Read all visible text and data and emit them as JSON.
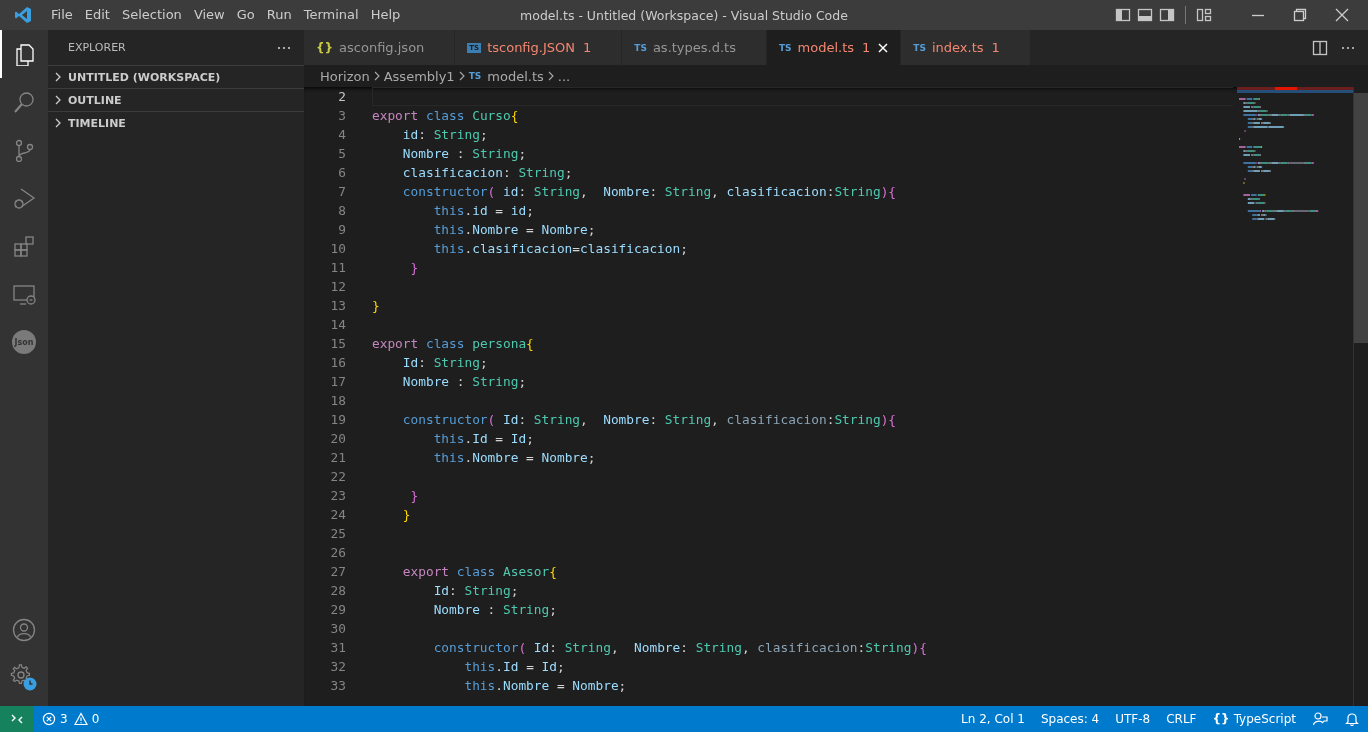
{
  "window": {
    "title": "model.ts - Untitled (Workspace) - Visual Studio Code"
  },
  "menu": [
    "File",
    "Edit",
    "Selection",
    "View",
    "Go",
    "Run",
    "Terminal",
    "Help"
  ],
  "activity_bar": [
    {
      "kind": "files",
      "selected": true
    },
    {
      "kind": "search",
      "selected": false
    },
    {
      "kind": "scm",
      "selected": false
    },
    {
      "kind": "debug",
      "selected": false
    },
    {
      "kind": "extensions",
      "selected": false
    },
    {
      "kind": "remote",
      "selected": false
    },
    {
      "kind": "json",
      "label": "Json",
      "selected": false
    }
  ],
  "activity_bottom": [
    {
      "kind": "account"
    },
    {
      "kind": "settings"
    }
  ],
  "sidebar": {
    "title": "EXPLORER",
    "sections": [
      {
        "label": "UNTITLED (WORKSPACE)",
        "expanded": false
      },
      {
        "label": "OUTLINE",
        "expanded": false
      },
      {
        "label": "TIMELINE",
        "expanded": false
      }
    ]
  },
  "tabs": [
    {
      "kind": "json",
      "icon_text": "{}",
      "label": "asconfig.json",
      "error": false,
      "selected": false
    },
    {
      "kind": "tsconfig",
      "icon_text": "TS",
      "label": "tsconfig.JSON",
      "problems": "1",
      "error": true,
      "selected": false
    },
    {
      "kind": "ts",
      "icon_text": "TS",
      "label": "as.types.d.ts",
      "error": false,
      "selected": false
    },
    {
      "kind": "ts",
      "icon_text": "TS",
      "label": "model.ts",
      "problems": "1",
      "error": true,
      "selected": true
    },
    {
      "kind": "ts",
      "icon_text": "TS",
      "label": "index.ts",
      "problems": "1",
      "error": true,
      "selected": false
    }
  ],
  "breadcrumb": [
    {
      "label": "Horizon"
    },
    {
      "label": "Assembly1"
    },
    {
      "label": "model.ts",
      "icon_text": "TS"
    },
    {
      "label": "..."
    }
  ],
  "code": [
    {
      "n": "2",
      "current": true
    },
    {
      "n": "3",
      "current": false,
      "tokens": [
        {
          "kind": "k",
          "text": "export"
        },
        {
          "kind": "s",
          "text": " class"
        },
        {
          "kind": "t",
          "text": " Curso"
        },
        {
          "kind": "b1",
          "text": "{"
        }
      ]
    },
    {
      "n": "4",
      "current": false,
      "tokens": [
        {
          "kind": "v",
          "text": "    id"
        },
        {
          "kind": "p",
          "text": ": "
        },
        {
          "kind": "t",
          "text": "String"
        },
        {
          "kind": "p",
          "text": ";"
        }
      ]
    },
    {
      "n": "5",
      "current": false,
      "tokens": [
        {
          "kind": "v",
          "text": "    Nombre"
        },
        {
          "kind": "p",
          "text": " : "
        },
        {
          "kind": "t",
          "text": "String"
        },
        {
          "kind": "p",
          "text": ";"
        }
      ]
    },
    {
      "n": "6",
      "current": false,
      "tokens": [
        {
          "kind": "v",
          "text": "    clasificacion"
        },
        {
          "kind": "p",
          "text": ": "
        },
        {
          "kind": "t",
          "text": "String"
        },
        {
          "kind": "p",
          "text": ";"
        }
      ]
    },
    {
      "n": "7",
      "current": false,
      "tokens": [
        {
          "kind": "s",
          "text": "    constructor"
        },
        {
          "kind": "b2",
          "text": "("
        },
        {
          "kind": "v",
          "text": " id"
        },
        {
          "kind": "p",
          "text": ": "
        },
        {
          "kind": "t",
          "text": "String"
        },
        {
          "kind": "p",
          "text": ",  "
        },
        {
          "kind": "v",
          "text": "Nombre"
        },
        {
          "kind": "p",
          "text": ": "
        },
        {
          "kind": "t",
          "text": "String"
        },
        {
          "kind": "p",
          "text": ", "
        },
        {
          "kind": "v",
          "text": "clasificacion"
        },
        {
          "kind": "p",
          "text": ":"
        },
        {
          "kind": "t",
          "text": "String"
        },
        {
          "kind": "b2",
          "text": "){"
        }
      ]
    },
    {
      "n": "8",
      "current": false,
      "tokens": [
        {
          "kind": "s",
          "text": "        this"
        },
        {
          "kind": "p",
          "text": "."
        },
        {
          "kind": "v",
          "text": "id"
        },
        {
          "kind": "p",
          "text": " = "
        },
        {
          "kind": "v",
          "text": "id"
        },
        {
          "kind": "p",
          "text": ";"
        }
      ]
    },
    {
      "n": "9",
      "current": false,
      "tokens": [
        {
          "kind": "s",
          "text": "        this"
        },
        {
          "kind": "p",
          "text": "."
        },
        {
          "kind": "v",
          "text": "Nombre"
        },
        {
          "kind": "p",
          "text": " = "
        },
        {
          "kind": "v",
          "text": "Nombre"
        },
        {
          "kind": "p",
          "text": ";"
        }
      ]
    },
    {
      "n": "10",
      "current": false,
      "tokens": [
        {
          "kind": "s",
          "text": "        this"
        },
        {
          "kind": "p",
          "text": "."
        },
        {
          "kind": "v",
          "text": "clasificacion"
        },
        {
          "kind": "p",
          "text": "="
        },
        {
          "kind": "v",
          "text": "clasificacion"
        },
        {
          "kind": "p",
          "text": ";"
        }
      ]
    },
    {
      "n": "11",
      "current": false,
      "tokens": [
        {
          "kind": "b2",
          "text": "     }"
        }
      ]
    },
    {
      "n": "12",
      "current": false
    },
    {
      "n": "13",
      "current": false,
      "tokens": [
        {
          "kind": "b1",
          "text": "}"
        }
      ]
    },
    {
      "n": "14",
      "current": false
    },
    {
      "n": "15",
      "current": false,
      "tokens": [
        {
          "kind": "k",
          "text": "export"
        },
        {
          "kind": "s",
          "text": " class"
        },
        {
          "kind": "t",
          "text": " persona"
        },
        {
          "kind": "b1",
          "text": "{"
        }
      ]
    },
    {
      "n": "16",
      "current": false,
      "tokens": [
        {
          "kind": "v",
          "text": "    Id"
        },
        {
          "kind": "p",
          "text": ": "
        },
        {
          "kind": "t",
          "text": "String"
        },
        {
          "kind": "p",
          "text": ";"
        }
      ]
    },
    {
      "n": "17",
      "current": false,
      "tokens": [
        {
          "kind": "v",
          "text": "    Nombre"
        },
        {
          "kind": "p",
          "text": " : "
        },
        {
          "kind": "t",
          "text": "String"
        },
        {
          "kind": "p",
          "text": ";"
        }
      ]
    },
    {
      "n": "18",
      "current": false
    },
    {
      "n": "19",
      "current": false,
      "tokens": [
        {
          "kind": "s",
          "text": "    constructor"
        },
        {
          "kind": "b2",
          "text": "("
        },
        {
          "kind": "v",
          "text": " Id"
        },
        {
          "kind": "p",
          "text": ": "
        },
        {
          "kind": "t",
          "text": "String"
        },
        {
          "kind": "p",
          "text": ",  "
        },
        {
          "kind": "v",
          "text": "Nombre"
        },
        {
          "kind": "p",
          "text": ": "
        },
        {
          "kind": "t",
          "text": "String"
        },
        {
          "kind": "p",
          "text": ", "
        },
        {
          "kind": "u",
          "text": "clasificacion"
        },
        {
          "kind": "p",
          "text": ":"
        },
        {
          "kind": "t",
          "text": "String"
        },
        {
          "kind": "b2",
          "text": "){"
        }
      ]
    },
    {
      "n": "20",
      "current": false,
      "tokens": [
        {
          "kind": "s",
          "text": "        this"
        },
        {
          "kind": "p",
          "text": "."
        },
        {
          "kind": "v",
          "text": "Id"
        },
        {
          "kind": "p",
          "text": " = "
        },
        {
          "kind": "v",
          "text": "Id"
        },
        {
          "kind": "p",
          "text": ";"
        }
      ]
    },
    {
      "n": "21",
      "current": false,
      "tokens": [
        {
          "kind": "s",
          "text": "        this"
        },
        {
          "kind": "p",
          "text": "."
        },
        {
          "kind": "v",
          "text": "Nombre"
        },
        {
          "kind": "p",
          "text": " = "
        },
        {
          "kind": "v",
          "text": "Nombre"
        },
        {
          "kind": "p",
          "text": ";"
        }
      ]
    },
    {
      "n": "22",
      "current": false
    },
    {
      "n": "23",
      "current": false,
      "tokens": [
        {
          "kind": "b2",
          "text": "     }"
        }
      ]
    },
    {
      "n": "24",
      "current": false,
      "tokens": [
        {
          "kind": "b1",
          "text": "    }"
        }
      ]
    },
    {
      "n": "25",
      "current": false
    },
    {
      "n": "26",
      "current": false
    },
    {
      "n": "27",
      "current": false,
      "tokens": [
        {
          "kind": "k",
          "text": "    export"
        },
        {
          "kind": "s",
          "text": " class"
        },
        {
          "kind": "t",
          "text": " Asesor"
        },
        {
          "kind": "b1",
          "text": "{"
        }
      ]
    },
    {
      "n": "28",
      "current": false,
      "tokens": [
        {
          "kind": "v",
          "text": "        Id"
        },
        {
          "kind": "p",
          "text": ": "
        },
        {
          "kind": "t",
          "text": "String"
        },
        {
          "kind": "p",
          "text": ";"
        }
      ]
    },
    {
      "n": "29",
      "current": false,
      "tokens": [
        {
          "kind": "v",
          "text": "        Nombre"
        },
        {
          "kind": "p",
          "text": " : "
        },
        {
          "kind": "t",
          "text": "String"
        },
        {
          "kind": "p",
          "text": ";"
        }
      ]
    },
    {
      "n": "30",
      "current": false
    },
    {
      "n": "31",
      "current": false,
      "tokens": [
        {
          "kind": "s",
          "text": "        constructor"
        },
        {
          "kind": "b2",
          "text": "("
        },
        {
          "kind": "v",
          "text": " Id"
        },
        {
          "kind": "p",
          "text": ": "
        },
        {
          "kind": "t",
          "text": "String"
        },
        {
          "kind": "p",
          "text": ",  "
        },
        {
          "kind": "v",
          "text": "Nombre"
        },
        {
          "kind": "p",
          "text": ": "
        },
        {
          "kind": "t",
          "text": "String"
        },
        {
          "kind": "p",
          "text": ", "
        },
        {
          "kind": "u",
          "text": "clasificacion"
        },
        {
          "kind": "p",
          "text": ":"
        },
        {
          "kind": "t",
          "text": "String"
        },
        {
          "kind": "b2",
          "text": "){"
        }
      ]
    },
    {
      "n": "32",
      "current": false,
      "tokens": [
        {
          "kind": "s",
          "text": "            this"
        },
        {
          "kind": "p",
          "text": "."
        },
        {
          "kind": "v",
          "text": "Id"
        },
        {
          "kind": "p",
          "text": " = "
        },
        {
          "kind": "v",
          "text": "Id"
        },
        {
          "kind": "p",
          "text": ";"
        }
      ]
    },
    {
      "n": "33",
      "current": false,
      "tokens": [
        {
          "kind": "s",
          "text": "            this"
        },
        {
          "kind": "p",
          "text": "."
        },
        {
          "kind": "v",
          "text": "Nombre"
        },
        {
          "kind": "p",
          "text": " = "
        },
        {
          "kind": "v",
          "text": "Nombre"
        },
        {
          "kind": "p",
          "text": ";"
        }
      ]
    }
  ],
  "status_bar": {
    "errors": "3",
    "warnings": "0",
    "items": [
      "Ln 2, Col 1",
      "Spaces: 4",
      "UTF-8",
      "CRLF"
    ],
    "language_icon": "{}",
    "language": "TypeScript"
  }
}
